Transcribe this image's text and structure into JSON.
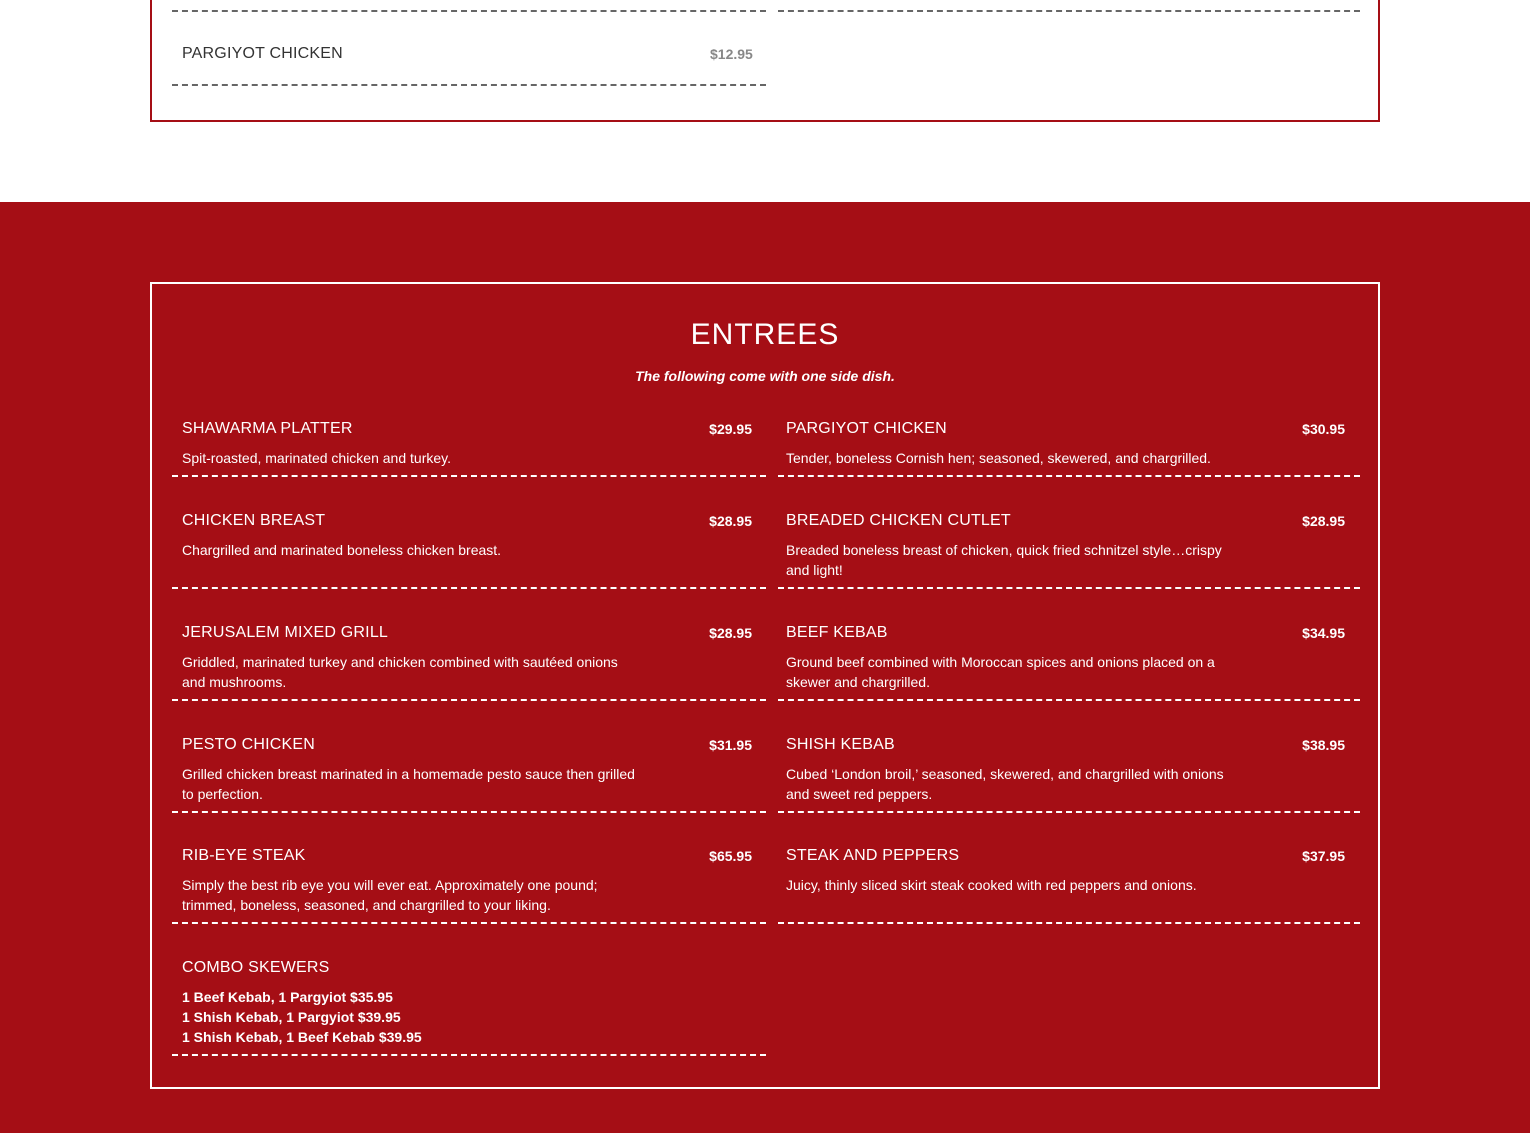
{
  "top_section": {
    "item": {
      "name": "PARGIYOT CHICKEN",
      "price": "$12.95"
    }
  },
  "entrees": {
    "title": "ENTREES",
    "subtitle": "The following come with one side dish.",
    "items": [
      {
        "name": "SHAWARMA PLATTER",
        "price": "$29.95",
        "description": "Spit-roasted, marinated chicken and turkey."
      },
      {
        "name": "PARGIYOT CHICKEN",
        "price": "$30.95",
        "description": "Tender, boneless Cornish hen; seasoned, skewered, and chargrilled."
      },
      {
        "name": "CHICKEN BREAST",
        "price": "$28.95",
        "description": "Chargrilled and marinated boneless chicken breast."
      },
      {
        "name": "BREADED CHICKEN CUTLET",
        "price": "$28.95",
        "description": "Breaded boneless breast of chicken, quick fried schnitzel style…crispy and light!"
      },
      {
        "name": "JERUSALEM MIXED GRILL",
        "price": "$28.95",
        "description": "Griddled, marinated turkey and chicken combined with sautéed onions and mushrooms."
      },
      {
        "name": "BEEF KEBAB",
        "price": "$34.95",
        "description": "Ground beef combined with Moroccan spices and onions placed on a skewer and chargrilled."
      },
      {
        "name": "PESTO CHICKEN",
        "price": "$31.95",
        "description": "Grilled chicken breast marinated in a homemade pesto sauce then grilled to perfection."
      },
      {
        "name": "SHISH KEBAB",
        "price": "$38.95",
        "description": "Cubed ‘London broil,’ seasoned, skewered, and chargrilled with onions and sweet red peppers."
      },
      {
        "name": "RIB-EYE STEAK",
        "price": "$65.95",
        "description": "Simply the best rib eye you will ever eat. Approximately one pound; trimmed, boneless, seasoned, and chargrilled to your liking."
      },
      {
        "name": "STEAK AND PEPPERS",
        "price": "$37.95",
        "description": "Juicy, thinly sliced skirt steak cooked with red peppers and onions."
      }
    ],
    "combo": {
      "name": "COMBO SKEWERS",
      "lines": [
        "1 Beef Kebab, 1 Pargyiot $35.95",
        "1 Shish Kebab, 1 Pargyiot $39.95",
        "1 Shish Kebab, 1 Beef Kebab $39.95"
      ]
    }
  },
  "colors": {
    "brand_red": "#a50e15",
    "white": "#ffffff",
    "dark_text": "#333333",
    "muted_price": "#888888"
  }
}
